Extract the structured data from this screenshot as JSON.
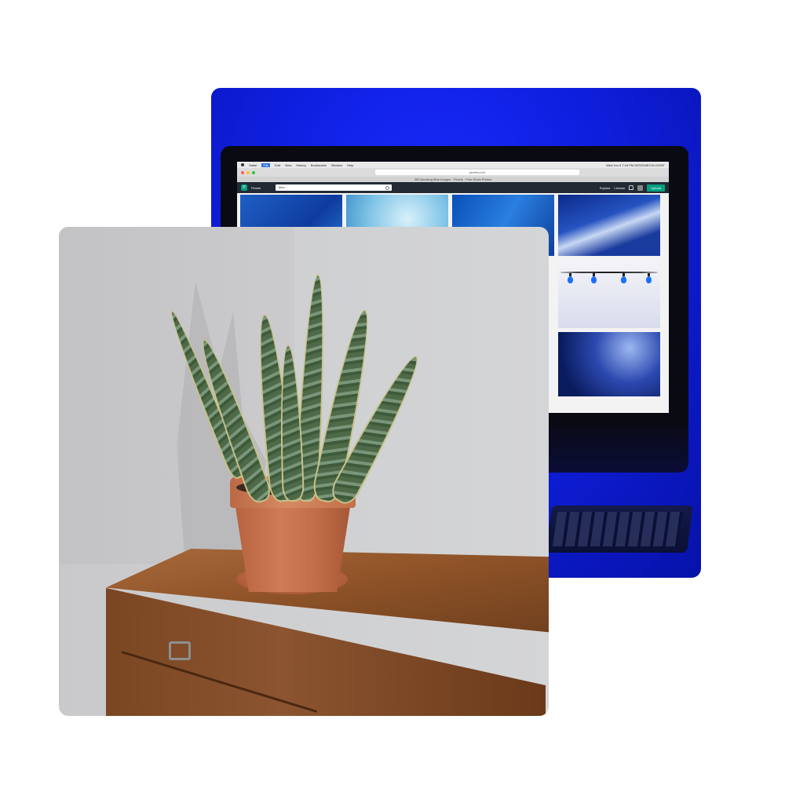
{
  "monitor_photo": {
    "mac_menu": [
      "Safari",
      "File",
      "Edit",
      "View",
      "History",
      "Bookmarks",
      "Window",
      "Help"
    ],
    "mac_status": "Wed Jun 9  7:44 PM  DESIGNECOLOGIST",
    "browser": {
      "url": "pexels.com",
      "tab_title": "300 Amazing Blue Images · Pexels · Free Stock Photos"
    },
    "pexels": {
      "logo_letter": "P",
      "brand": "Pexels",
      "search_value": "blue",
      "nav": [
        "Explore",
        "License"
      ],
      "upload_label": "Upload"
    }
  },
  "colors": {
    "backdrop_blue": "#0f1fe0",
    "pexels_green": "#05a081",
    "pot_terracotta": "#c06d48",
    "wood": "#8f5328"
  }
}
